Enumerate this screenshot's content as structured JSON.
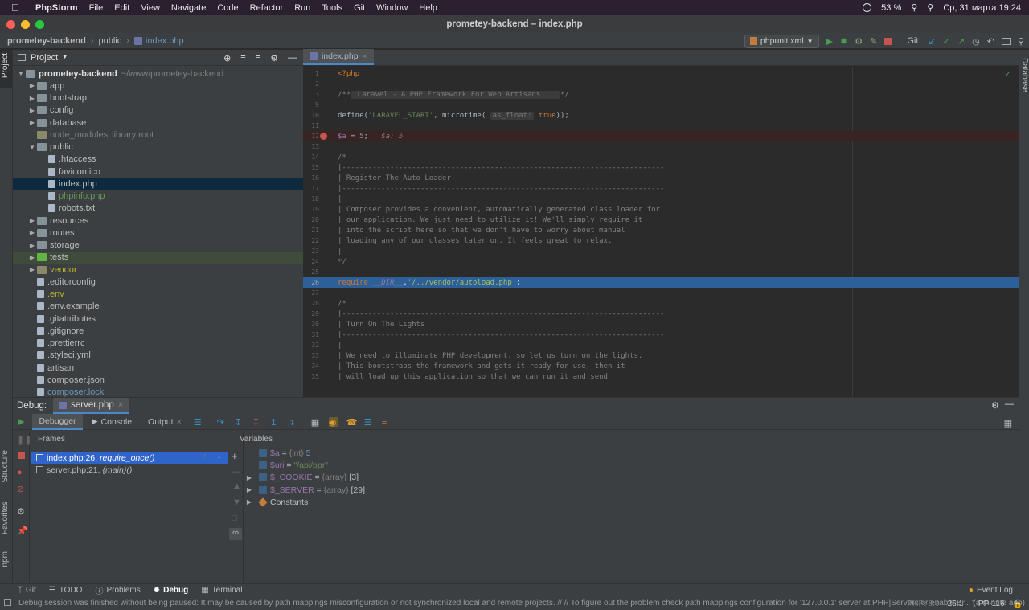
{
  "menubar": {
    "app_name": "PhpStorm",
    "items": [
      "File",
      "Edit",
      "View",
      "Navigate",
      "Code",
      "Refactor",
      "Run",
      "Tools",
      "Git",
      "Window",
      "Help"
    ],
    "battery": "53 %",
    "datetime": "Ср, 31 марта  19:24"
  },
  "window": {
    "title": "prometey-backend – index.php"
  },
  "breadcrumb": [
    "prometey-backend",
    "public",
    "index.php"
  ],
  "run_config": "phpunit.xml",
  "git_label": "Git:",
  "project_panel": {
    "title": "Project",
    "root_name": "prometey-backend",
    "root_path": "~/www/prometey-backend",
    "items": [
      {
        "name": "app",
        "type": "folder",
        "depth": 1,
        "expand": "collapsed"
      },
      {
        "name": "bootstrap",
        "type": "folder",
        "depth": 1,
        "expand": "collapsed"
      },
      {
        "name": "config",
        "type": "folder",
        "depth": 1,
        "expand": "collapsed"
      },
      {
        "name": "database",
        "type": "folder",
        "depth": 1,
        "expand": "collapsed"
      },
      {
        "name": "node_modules",
        "type": "folder",
        "depth": 1,
        "expand": "none",
        "hint": "library root"
      },
      {
        "name": "public",
        "type": "folder",
        "depth": 1,
        "expand": "expanded"
      },
      {
        "name": ".htaccess",
        "type": "file",
        "depth": 2,
        "expand": "none"
      },
      {
        "name": "favicon.ico",
        "type": "file",
        "depth": 2,
        "expand": "none"
      },
      {
        "name": "index.php",
        "type": "file",
        "depth": 2,
        "expand": "none",
        "state": "selected"
      },
      {
        "name": "phpinfo.php",
        "type": "file",
        "depth": 2,
        "expand": "none",
        "color": "#629755"
      },
      {
        "name": "robots.txt",
        "type": "file",
        "depth": 2,
        "expand": "none"
      },
      {
        "name": "resources",
        "type": "folder",
        "depth": 1,
        "expand": "collapsed"
      },
      {
        "name": "routes",
        "type": "folder",
        "depth": 1,
        "expand": "collapsed"
      },
      {
        "name": "storage",
        "type": "folder",
        "depth": 1,
        "expand": "collapsed"
      },
      {
        "name": "tests",
        "type": "folder",
        "depth": 1,
        "expand": "collapsed",
        "state": "highlight"
      },
      {
        "name": "vendor",
        "type": "folder",
        "depth": 1,
        "expand": "collapsed",
        "color": "#bbb529"
      },
      {
        "name": ".editorconfig",
        "type": "file",
        "depth": 1,
        "expand": "none"
      },
      {
        "name": ".env",
        "type": "file",
        "depth": 1,
        "expand": "none",
        "color": "#bbb529"
      },
      {
        "name": ".env.example",
        "type": "file",
        "depth": 1,
        "expand": "none"
      },
      {
        "name": ".gitattributes",
        "type": "file",
        "depth": 1,
        "expand": "none"
      },
      {
        "name": ".gitignore",
        "type": "file",
        "depth": 1,
        "expand": "none"
      },
      {
        "name": ".prettierrc",
        "type": "file",
        "depth": 1,
        "expand": "none"
      },
      {
        "name": ".styleci.yml",
        "type": "file",
        "depth": 1,
        "expand": "none"
      },
      {
        "name": "artisan",
        "type": "file",
        "depth": 1,
        "expand": "none"
      },
      {
        "name": "composer.json",
        "type": "file",
        "depth": 1,
        "expand": "none"
      },
      {
        "name": "composer.lock",
        "type": "file",
        "depth": 1,
        "expand": "none",
        "color": "#6897bb"
      }
    ]
  },
  "editor": {
    "tab": "index.php",
    "lines": [
      {
        "n": "1",
        "html": "<span class='kw'>&lt;?php</span>"
      },
      {
        "n": "2",
        "html": ""
      },
      {
        "n": "3",
        "html": "<span class='cmt'>/**</span><span class='hintbox'> Laravel - A PHP Framework For Web Artisans ...</span><span class='cmt'>*/</span>"
      },
      {
        "n": "9",
        "html": ""
      },
      {
        "n": "10",
        "html": "define(<span class='str'>'LARAVEL_START'</span>, microtime( <span class='hintbox'>as_float:</span> <span class='kw'>true</span>));"
      },
      {
        "n": "11",
        "html": ""
      },
      {
        "n": "12",
        "html": "<span class='var'>$a</span> = <span style='color:#6897bb'>5</span>;   <span class='cmt' style='font-style:italic'>$a: 5</span>",
        "type": "bp"
      },
      {
        "n": "13",
        "html": ""
      },
      {
        "n": "14",
        "html": "<span class='cmt'>/*</span>"
      },
      {
        "n": "15",
        "html": "<span class='cmt'>|--------------------------------------------------------------------------</span>"
      },
      {
        "n": "16",
        "html": "<span class='cmt'>| Register The Auto Loader</span>"
      },
      {
        "n": "17",
        "html": "<span class='cmt'>|--------------------------------------------------------------------------</span>"
      },
      {
        "n": "18",
        "html": "<span class='cmt'>|</span>"
      },
      {
        "n": "19",
        "html": "<span class='cmt'>| Composer provides a convenient, automatically generated class loader for</span>"
      },
      {
        "n": "20",
        "html": "<span class='cmt'>| our application. We just need to utilize it! We'll simply require it</span>"
      },
      {
        "n": "21",
        "html": "<span class='cmt'>| into the script here so that we don't have to worry about manual</span>"
      },
      {
        "n": "22",
        "html": "<span class='cmt'>| loading any of our classes later on. It feels great to relax.</span>"
      },
      {
        "n": "23",
        "html": "<span class='cmt'>|</span>"
      },
      {
        "n": "24",
        "html": "<span class='cmt'>*/</span>"
      },
      {
        "n": "25",
        "html": ""
      },
      {
        "n": "26",
        "html": "<span style='color:#cc7832'>require</span> <span style='color:#9876aa;font-style:italic'>__DIR__</span>.<span style='color:#a5c261'>'/../vendor/autoload.php'</span>;",
        "type": "exec"
      },
      {
        "n": "27",
        "html": ""
      },
      {
        "n": "28",
        "html": "<span class='cmt'>/*</span>"
      },
      {
        "n": "29",
        "html": "<span class='cmt'>|--------------------------------------------------------------------------</span>"
      },
      {
        "n": "30",
        "html": "<span class='cmt'>| Turn On The Lights</span>"
      },
      {
        "n": "31",
        "html": "<span class='cmt'>|--------------------------------------------------------------------------</span>"
      },
      {
        "n": "32",
        "html": "<span class='cmt'>|</span>"
      },
      {
        "n": "33",
        "html": "<span class='cmt'>| We need to illuminate PHP development, so let us turn on the lights.</span>"
      },
      {
        "n": "34",
        "html": "<span class='cmt'>| This bootstraps the framework and gets it ready for use, then it</span>"
      },
      {
        "n": "35",
        "html": "<span class='cmt'>| will load up this application so that we can run it and send</span>"
      }
    ]
  },
  "debug": {
    "label": "Debug:",
    "session": "server.php",
    "tabs": [
      "Debugger",
      "Console",
      "Output"
    ],
    "frames_label": "Frames",
    "variables_label": "Variables",
    "frames": [
      {
        "loc": "index.php:26,",
        "fn": "require_once()"
      },
      {
        "loc": "server.php:21,",
        "fn": "{main}()"
      }
    ],
    "variables": [
      {
        "name": "$a",
        "eq": " = ",
        "type": "{int}",
        "value": " 5",
        "vclass": "vnum",
        "expand": false
      },
      {
        "name": "$uri",
        "eq": " = ",
        "type": "",
        "value": "\"/api/ppr\"",
        "vclass": "vstr",
        "expand": false
      },
      {
        "name": "$_COOKIE",
        "eq": " = ",
        "type": "{array}",
        "value": " [3]",
        "vclass": "",
        "expand": true
      },
      {
        "name": "$_SERVER",
        "eq": " = ",
        "type": "{array}",
        "value": " [29]",
        "vclass": "",
        "expand": true
      },
      {
        "name": "Constants",
        "eq": "",
        "type": "",
        "value": "",
        "vclass": "",
        "expand": true
      }
    ]
  },
  "bottom_tools": [
    "Git",
    "TODO",
    "Problems",
    "Debug",
    "Terminal"
  ],
  "event_log": "Event Log",
  "left_strip": [
    "Project",
    "Structure",
    "Favorites",
    "npm"
  ],
  "right_strip": [
    "Database"
  ],
  "status": {
    "message": "Debug session was finished without being paused: It may be caused by path mappings misconfiguration or not synchronized local and remote projects. // // To figure out the problem check path mappings configuration for '127.0.0.1' server at PHP|Servers or enable Br... (a minute ago)",
    "php": "PHP: 8.0",
    "position": "26:1",
    "branch": "PP-116"
  }
}
